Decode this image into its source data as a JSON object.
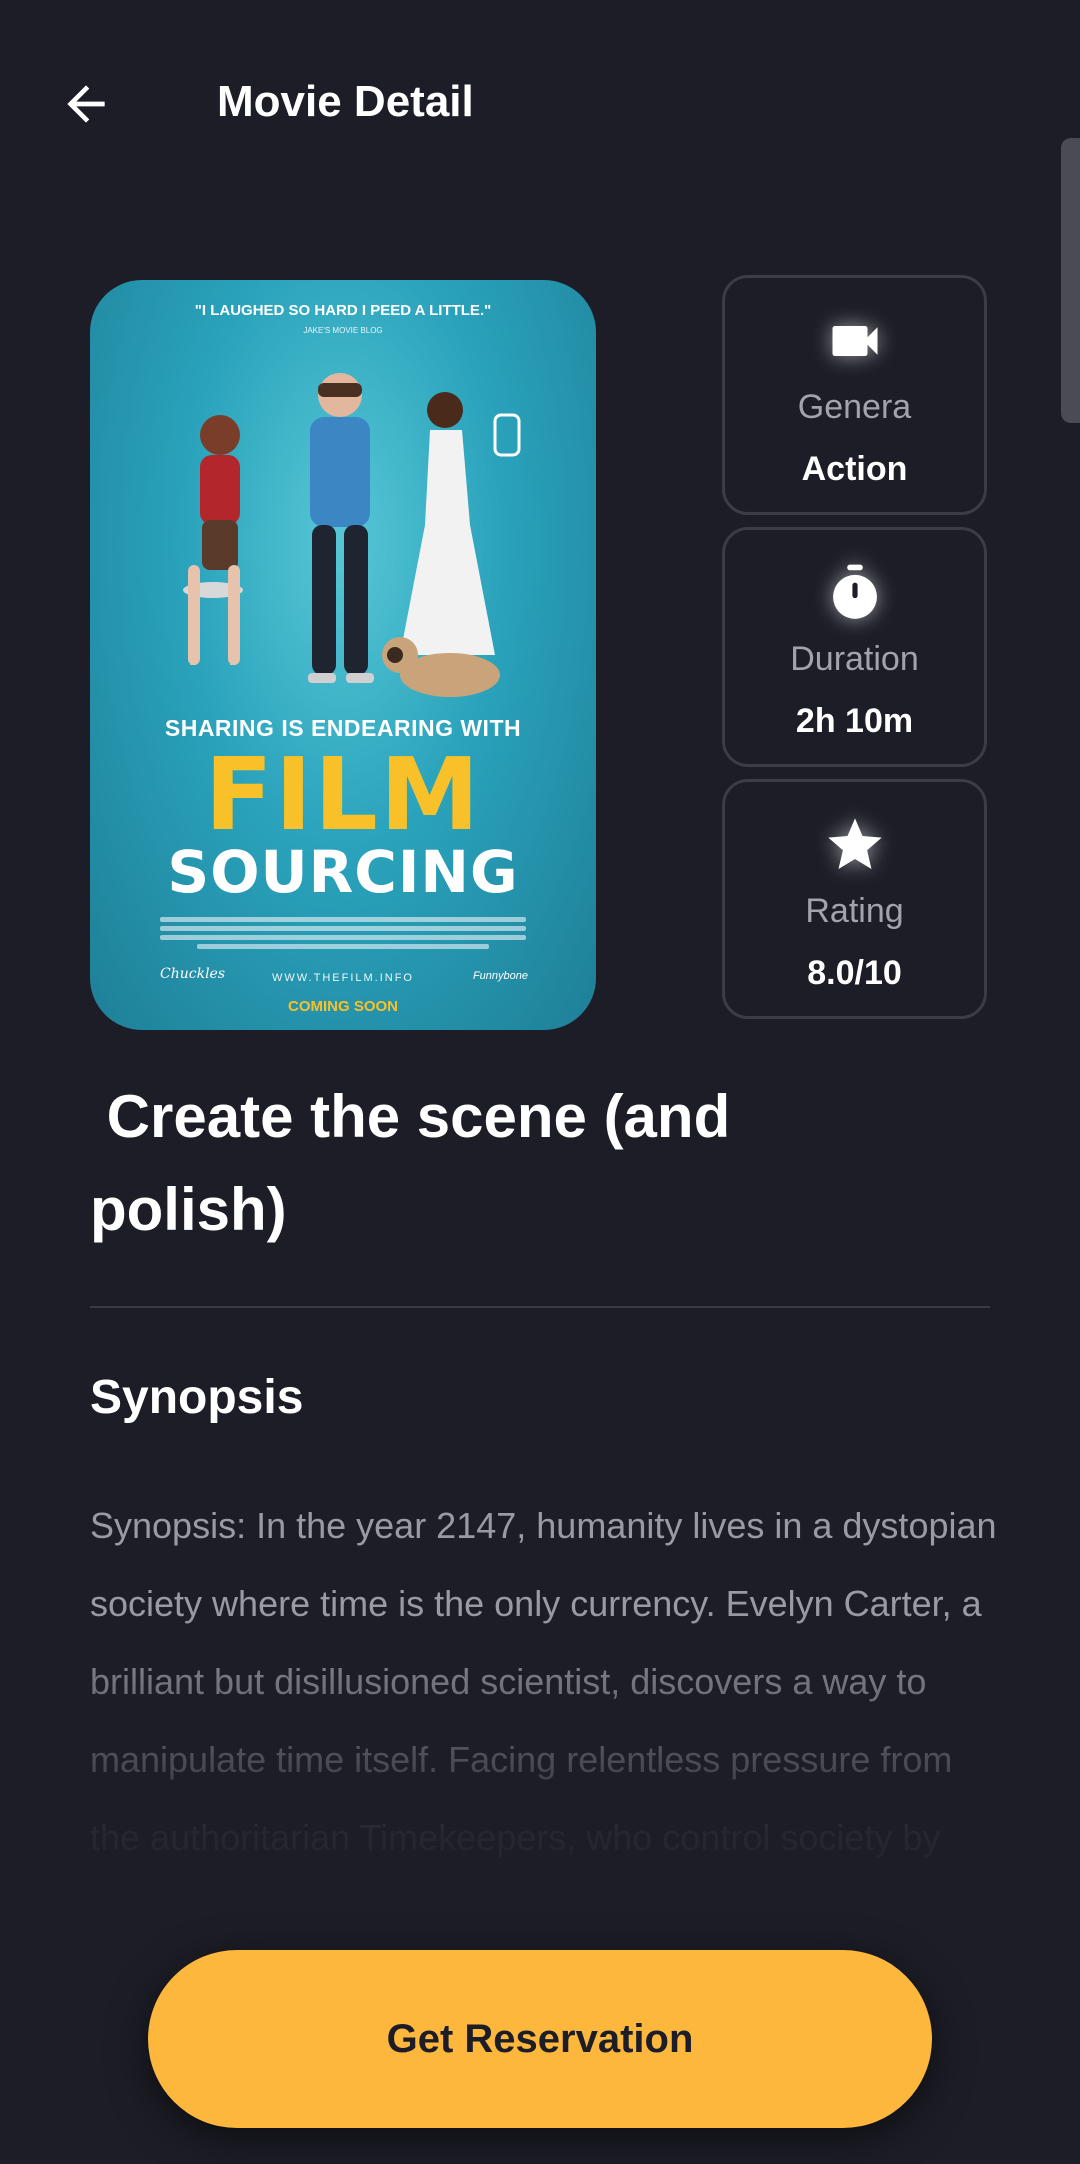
{
  "appbar": {
    "title": "Movie Detail"
  },
  "poster": {
    "quote": "\"I LAUGHED SO HARD I PEED A LITTLE.\"",
    "quote_source": "JAKE'S MOVIE BLOG",
    "tagline": "SHARING IS ENDEARING WITH",
    "title_line1": "FILM",
    "title_line2": "SOURCING",
    "studio_left": "Chuckles",
    "url": "WWW.THEFILM.INFO",
    "studio_right": "Funnybone",
    "coming_soon": "COMING SOON"
  },
  "info": {
    "genre": {
      "label": "Genera",
      "value": "Action",
      "icon": "video-camera-icon"
    },
    "duration": {
      "label": "Duration",
      "value": "2h 10m",
      "icon": "stopwatch-icon"
    },
    "rating": {
      "label": "Rating",
      "value": "8.0/10",
      "icon": "star-icon"
    }
  },
  "movie": {
    "title": " Create the scene (and polish)"
  },
  "synopsis": {
    "heading": "Synopsis",
    "text": "Synopsis: In the year 2147, humanity lives in a dystopian society where time is the only currency. Evelyn Carter, a brilliant but disillusioned scientist, discovers a way to manipulate time itself. Facing relentless pressure from the authoritarian Timekeepers, who control society by"
  },
  "cta": {
    "label": "Get Reservation",
    "color": "#fdb73d"
  },
  "colors": {
    "background": "#1d1d27",
    "card_border": "#3c3c47",
    "muted_text": "#a3a3ad"
  }
}
